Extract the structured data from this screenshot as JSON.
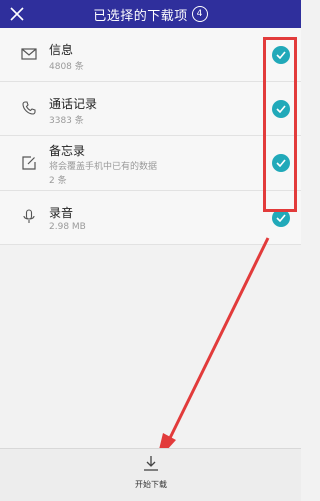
{
  "header": {
    "title": "已选择的下载项",
    "count": "4"
  },
  "items": [
    {
      "name": "信息",
      "detail": "4808 条",
      "icon": "message-icon"
    },
    {
      "name": "通话记录",
      "detail": "3383 条",
      "icon": "phone-icon"
    },
    {
      "name": "备忘录",
      "note": "将会覆盖手机中已有的数据",
      "detail": "2 条",
      "icon": "memo-icon"
    },
    {
      "name": "录音",
      "detail": "2.98 MB",
      "icon": "microphone-icon"
    }
  ],
  "footer": {
    "download_label": "开始下载"
  },
  "colors": {
    "header_bg": "#2f2f9c",
    "check": "#21a9b9",
    "annotation": "#e23b3b"
  }
}
